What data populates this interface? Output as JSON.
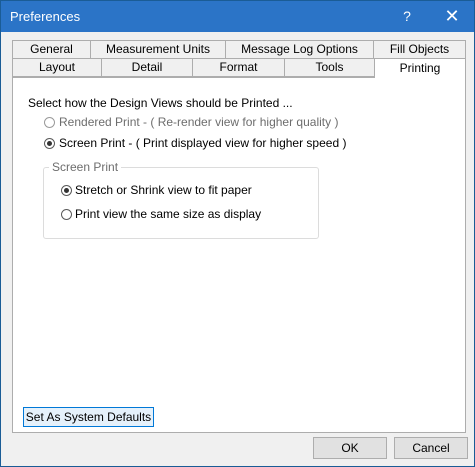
{
  "window": {
    "title": "Preferences",
    "help_glyph": "?",
    "close_glyph": "✕"
  },
  "tabs": {
    "row1": [
      "General",
      "Measurement Units",
      "Message Log Options",
      "Fill Objects"
    ],
    "row2": [
      "Layout",
      "Detail",
      "Format",
      "Tools",
      "Printing"
    ]
  },
  "panel": {
    "prompt": "Select how the Design Views should be Printed ...",
    "options": [
      {
        "label": "Rendered Print - ( Re-render view for higher quality )",
        "checked": false,
        "enabled": false
      },
      {
        "label": "Screen Print - ( Print displayed view for higher speed )",
        "checked": true,
        "enabled": true
      }
    ],
    "group": {
      "label": "Screen Print",
      "options": [
        {
          "label": "Stretch or Shrink view to fit paper",
          "checked": true
        },
        {
          "label": "Print view the same size as display",
          "checked": false
        }
      ]
    },
    "defaults_button": "Set As System Defaults"
  },
  "footer": {
    "ok": "OK",
    "cancel": "Cancel"
  }
}
